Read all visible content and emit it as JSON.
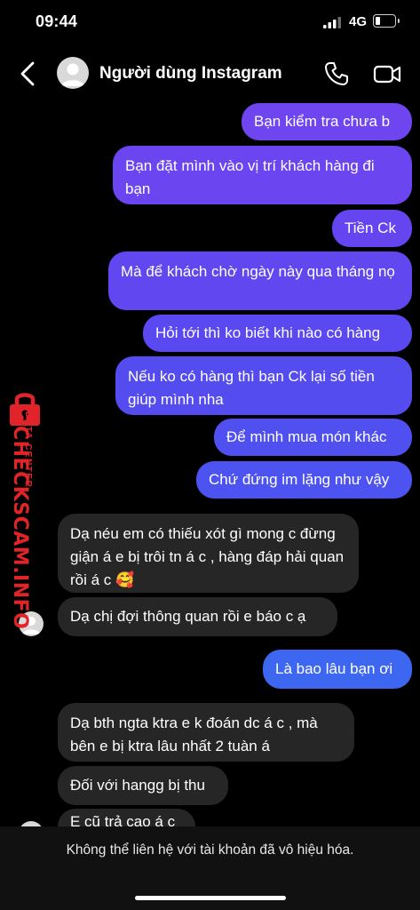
{
  "status_bar": {
    "time": "09:44",
    "network": "4G"
  },
  "header": {
    "title": "Người dùng Instagram"
  },
  "colors": {
    "accent_purple": "#6f45f0",
    "accent_blue": "#3d67f0",
    "incoming_bubble": "#262626",
    "watermark_red": "#e0242a"
  },
  "messages": {
    "out_1": "Bạn kiểm tra chưa b",
    "out_2": "Bạn đặt mình vào vị trí khách hàng đi bạn",
    "out_3": "Tiền Ck",
    "out_4": "Mà để khách chờ ngày này qua tháng nọ",
    "out_5": "Hỏi tới thì ko biết khi nào có hàng",
    "out_6": "Nếu ko có hàng thì bạn Ck lại số tiền giúp mình nha",
    "out_7": "Để mình mua món khác",
    "out_8": "Chứ đứng im lặng như vậy",
    "in_1": "Dạ néu em có thiếu xót gì mong c đừng giận á e bị trôi tn á c , hàng đáp hải quan rồi á c 🥰",
    "in_2": "Dạ chị đợi thông quan rồi e báo c ạ",
    "out_9": "Là bao lâu bạn ơi",
    "in_3": "Dạ bth ngta ktra e k đoán dc á c , mà bên e bị ktra lâu nhất 2 tuàn á",
    "in_4": "Đối với hangg bị thu",
    "in_5": "E cũ trả cao á c"
  },
  "watermark": {
    "main": "CHECKSCAM.INFO",
    "sub": "DATA CENTER"
  },
  "banner": {
    "text": "Không thể liên hệ với tài khoản đã vô hiệu hóa."
  }
}
